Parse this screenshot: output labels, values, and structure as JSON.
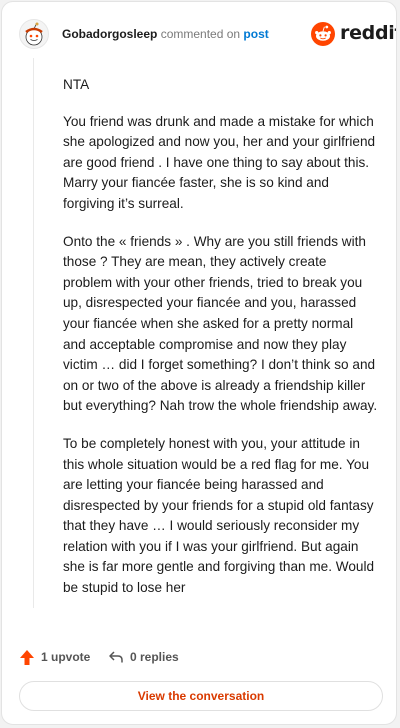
{
  "header": {
    "username": "Gobadorgosleep",
    "action": "commented on",
    "post_link": "post",
    "brand": "reddit"
  },
  "comment": {
    "paragraphs": [
      "NTA",
      "You friend was drunk and made a mistake for which she apologized and now you, her and your girlfriend are good friend . I have one thing to say about this. Marry your fiancée faster, she is so kind and forgiving it’s surreal.",
      "Onto the « friends » . Why are you still friends with those ? They are mean, they actively create problem with your other friends, tried to break you up, disrespected your fiancée and you, harassed your fiancée when she asked for a pretty normal and acceptable compromise and now they play victim … did I forget something? I don’t think so and on or two of the above is already a friendship killer but everything? Nah trow the whole friendship away.",
      "To be completely honest with you, your attitude in this whole situation would be a red flag for me. You are letting your fiancée being harassed and disrespected by your friends for a stupid old fantasy that they have … I would seriously reconsider my relation with you if I was your girlfriend. But again she is far more gentle and forgiving than me. Would be stupid to lose her"
    ]
  },
  "actions": {
    "upvotes": "1 upvote",
    "replies": "0 replies",
    "view_button": "View the conversation"
  },
  "colors": {
    "brand": "#ff4500",
    "link": "#0079d3",
    "cta": "#d93a00"
  }
}
